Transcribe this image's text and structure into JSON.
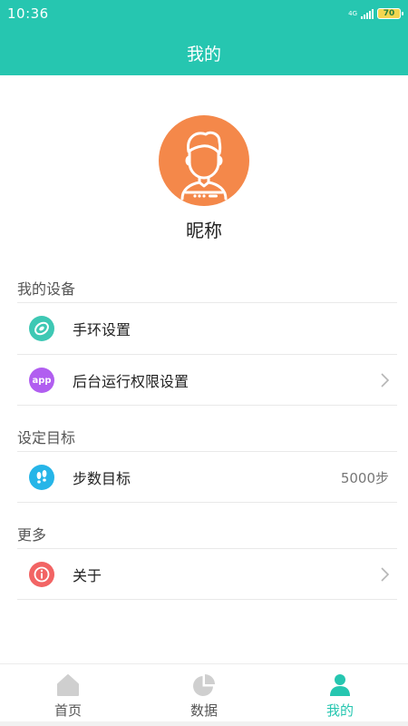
{
  "status_bar": {
    "time": "10:36",
    "network": "4G",
    "battery": "70"
  },
  "header": {
    "title": "我的",
    "background_color": "#26c6b0"
  },
  "profile": {
    "nickname": "昵称",
    "avatar_icon": "user-avatar-icon",
    "avatar_color": "#f4884a"
  },
  "sections": {
    "devices": {
      "title": "我的设备",
      "items": [
        {
          "label": "手环设置",
          "icon": "band-icon",
          "icon_color": "#3ec8b4"
        },
        {
          "label": "后台运行权限设置",
          "icon": "app-icon",
          "icon_text": "app",
          "icon_color": "#b15ef0",
          "chevron": true
        }
      ]
    },
    "goals": {
      "title": "设定目标",
      "items": [
        {
          "label": "步数目标",
          "value": "5000步",
          "icon": "footprints-icon",
          "icon_color": "#26b5e8"
        }
      ]
    },
    "more": {
      "title": "更多",
      "items": [
        {
          "label": "关于",
          "icon": "info-icon",
          "icon_color": "#f26464",
          "chevron": true
        }
      ]
    }
  },
  "bottom_nav": {
    "items": [
      {
        "label": "首页",
        "icon": "home-icon",
        "active": false
      },
      {
        "label": "数据",
        "icon": "pie-chart-icon",
        "active": false
      },
      {
        "label": "我的",
        "icon": "person-icon",
        "active": true
      }
    ],
    "active_color": "#26c6b0",
    "inactive_color": "#cfcfcf"
  }
}
